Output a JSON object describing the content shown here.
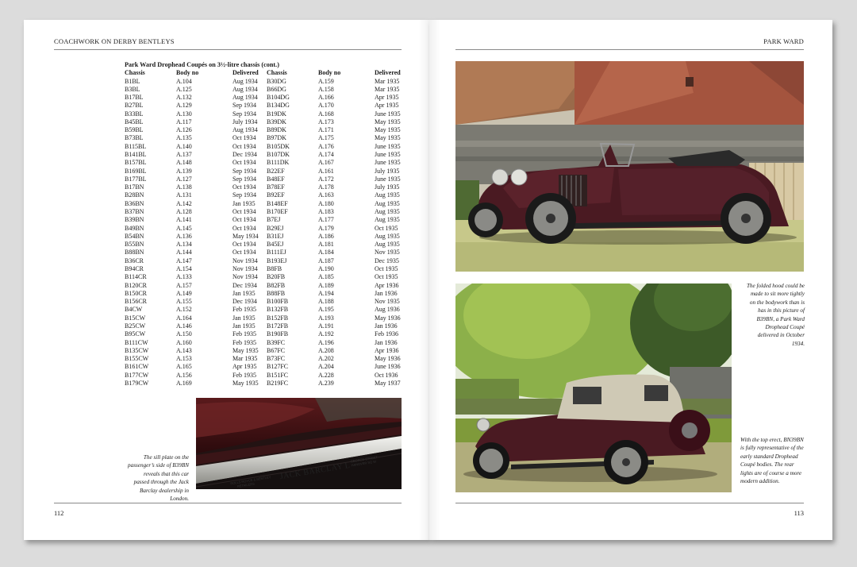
{
  "left_page": {
    "running_head": "COACHWORK ON DERBY BENTLEYS",
    "folio": "112",
    "table": {
      "title": "Park Ward Drophead Coupés on 3½-litre chassis (cont.)",
      "headers": [
        "Chassis",
        "Body no",
        "Delivered",
        "Chassis",
        "Body no",
        "Delivered"
      ],
      "rows": [
        [
          "B1BL",
          "A.104",
          "Aug 1934",
          "B30DG",
          "A.159",
          "Mar 1935"
        ],
        [
          "B3BL",
          "A.125",
          "Aug 1934",
          "B66DG",
          "A.158",
          "Mar 1935"
        ],
        [
          "B17BL",
          "A.132",
          "Aug 1934",
          "B104DG",
          "A.166",
          "Apr 1935"
        ],
        [
          "B27BL",
          "A.129",
          "Sep 1934",
          "B134DG",
          "A.170",
          "Apr 1935"
        ],
        [
          "B33BL",
          "A.130",
          "Sep 1934",
          "B19DK",
          "A.168",
          "June 1935"
        ],
        [
          "B45BL",
          "A.117",
          "July 1934",
          "B39DK",
          "A.173",
          "May 1935"
        ],
        [
          "B59BL",
          "A.126",
          "Aug 1934",
          "B89DK",
          "A.171",
          "May 1935"
        ],
        [
          "B73BL",
          "A.135",
          "Oct 1934",
          "B97DK",
          "A.175",
          "May 1935"
        ],
        [
          "B115BL",
          "A.140",
          "Oct 1934",
          "B105DK",
          "A.176",
          "June 1935"
        ],
        [
          "B141BL",
          "A.137",
          "Dec 1934",
          "B107DK",
          "A.174",
          "June 1935"
        ],
        [
          "B157BL",
          "A.148",
          "Oct 1934",
          "B111DK",
          "A.167",
          "June 1935"
        ],
        [
          "B169BL",
          "A.139",
          "Sep 1934",
          "B22EF",
          "A.161",
          "July 1935"
        ],
        [
          "B177BL",
          "A.127",
          "Sep 1934",
          "B48EF",
          "A.172",
          "June 1935"
        ],
        [
          "B17BN",
          "A.138",
          "Oct 1934",
          "B78EF",
          "A.178",
          "July 1935"
        ],
        [
          "B28BN",
          "A.131",
          "Sep 1934",
          "B92EF",
          "A.163",
          "Aug 1935"
        ],
        [
          "B36BN",
          "A.142",
          "Jan 1935",
          "B148EF",
          "A.180",
          "Aug 1935"
        ],
        [
          "B37BN",
          "A.128",
          "Oct 1934",
          "B170EF",
          "A.183",
          "Aug 1935"
        ],
        [
          "B39BN",
          "A.141",
          "Oct 1934",
          "B7EJ",
          "A.177",
          "Aug 1935"
        ],
        [
          "B49BN",
          "A.145",
          "Oct 1934",
          "B29EJ",
          "A.179",
          "Oct 1935"
        ],
        [
          "B54BN",
          "A.136",
          "May 1934",
          "B31EJ",
          "A.186",
          "Aug 1935"
        ],
        [
          "B55BN",
          "A.134",
          "Oct 1934",
          "B45EJ",
          "A.181",
          "Aug 1935"
        ],
        [
          "B88BN",
          "A.144",
          "Oct 1934",
          "B111EJ",
          "A.184",
          "Nov 1935"
        ],
        [
          "B36CR",
          "A.147",
          "Nov 1934",
          "B193EJ",
          "A.187",
          "Dec 1935"
        ],
        [
          "B94CR",
          "A.154",
          "Nov 1934",
          "B8FB",
          "A.190",
          "Oct 1935"
        ],
        [
          "B114CR",
          "A.133",
          "Nov 1934",
          "B20FB",
          "A.185",
          "Oct 1935"
        ],
        [
          "B120CR",
          "A.157",
          "Dec 1934",
          "B82FB",
          "A.189",
          "Apr 1936"
        ],
        [
          "B150CR",
          "A.149",
          "Jan 1935",
          "B88FB",
          "A.194",
          "Jan 1936"
        ],
        [
          "B156CR",
          "A.155",
          "Dec 1934",
          "B100FB",
          "A.188",
          "Nov 1935"
        ],
        [
          "B4CW",
          "A.152",
          "Feb 1935",
          "B132FB",
          "A.195",
          "Aug 1936"
        ],
        [
          "B15CW",
          "A.164",
          "Jan 1935",
          "B152FB",
          "A.193",
          "May 1936"
        ],
        [
          "B25CW",
          "A.146",
          "Jan 1935",
          "B172FB",
          "A.191",
          "Jan 1936"
        ],
        [
          "B95CW",
          "A.150",
          "Feb 1935",
          "B190FB",
          "A.192",
          "Feb 1936"
        ],
        [
          "B111CW",
          "A.160",
          "Feb 1935",
          "B39FC",
          "A.196",
          "Jan 1936"
        ],
        [
          "B135CW",
          "A.143",
          "May 1935",
          "B67FC",
          "A.208",
          "Apr 1936"
        ],
        [
          "B155CW",
          "A.153",
          "Mar 1935",
          "B73FC",
          "A.202",
          "May 1936"
        ],
        [
          "B161CW",
          "A.165",
          "Apr 1935",
          "B127FC",
          "A.204",
          "June 1936"
        ],
        [
          "B177CW",
          "A.156",
          "Feb 1935",
          "B151FC",
          "A.228",
          "Oct 1936"
        ],
        [
          "B179CW",
          "A.169",
          "May 1935",
          "B219FC",
          "A.239",
          "May 1937"
        ]
      ]
    },
    "sill_caption": "The sill plate on the passenger’s side of B39BN reveals that this car passed through the Jack Barclay dealership in London.",
    "sill_plate": {
      "main": "JACK BARCLAY L",
      "left_line1": "ROLLS ROYCE & BENTLEY",
      "left_line2": "RETAILERS",
      "right_line1": "GEORGE STREET",
      "right_line2": "HANOVER SQ W"
    }
  },
  "right_page": {
    "running_head": "PARK WARD",
    "folio": "113",
    "caption_top": "The folded hood could be made to sit more tightly on the bodywork than is has in this picture of B39BN, a Park Ward Drophead Coupé delivered in October 1934.",
    "caption_bottom": "With the top erect, BN39BN is fully representative of the early standard Drophead Coupé bodies. The rear lights are of course a more modern addition."
  },
  "colors": {
    "background": "#dcdcdc",
    "paper": "#ffffff",
    "car_body": "#4a1a22",
    "brick": "#a4543e"
  }
}
